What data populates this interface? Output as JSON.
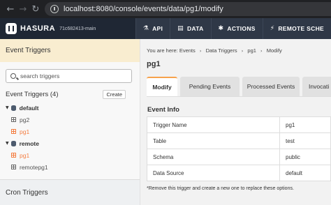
{
  "browser": {
    "url": "localhost:8080/console/events/data/pg1/modify"
  },
  "topnav": {
    "brand": "HASURA",
    "version": "71c682413-main",
    "items": [
      {
        "label": "API",
        "icon": "flask-icon"
      },
      {
        "label": "DATA",
        "icon": "database-icon"
      },
      {
        "label": "ACTIONS",
        "icon": "cog-icon"
      },
      {
        "label": "REMOTE SCHE",
        "icon": "plug-icon"
      }
    ]
  },
  "sidebar": {
    "header": "Event Triggers",
    "search_placeholder": "search triggers",
    "triggers_label": "Event Triggers (4)",
    "create_label": "Create",
    "schemas": [
      {
        "name": "default",
        "triggers": [
          "pg2",
          "pg1"
        ]
      },
      {
        "name": "remote",
        "triggers": [
          "pg1",
          "remotepg1"
        ]
      }
    ],
    "cron_label": "Cron Triggers"
  },
  "main": {
    "breadcrumb": [
      "You are here: Events",
      "Data Triggers",
      "pg1",
      "Modify"
    ],
    "title": "pg1",
    "tabs": [
      "Modify",
      "Pending Events",
      "Processed Events",
      "Invocati"
    ],
    "section_title": "Event Info",
    "info_rows": [
      {
        "key": "Trigger Name",
        "value": "pg1"
      },
      {
        "key": "Table",
        "value": "test"
      },
      {
        "key": "Schema",
        "value": "public"
      },
      {
        "key": "Data Source",
        "value": "default"
      }
    ],
    "note": "*Remove this trigger and create a new one to replace these options."
  },
  "colors": {
    "accent": "#f47e42",
    "tab_accent": "#f7a24b",
    "nav_bg": "#2f3847",
    "sidebar_header_bg": "#f9edd0"
  }
}
